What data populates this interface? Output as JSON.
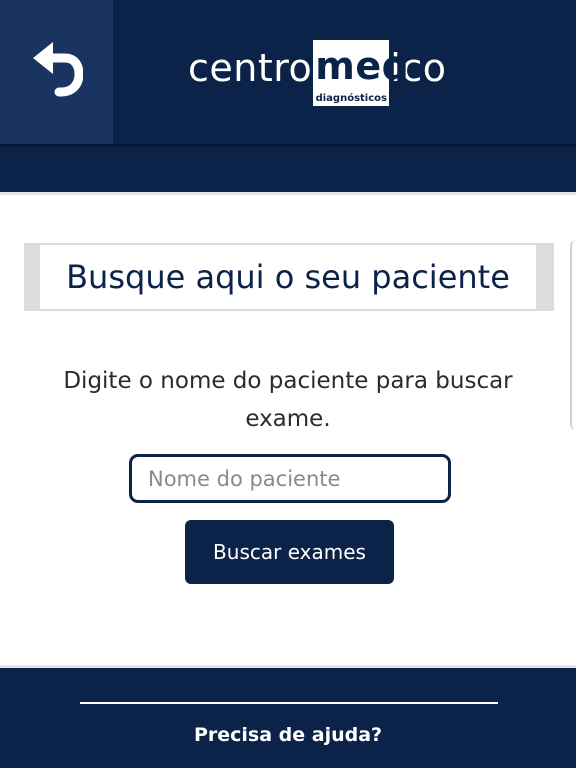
{
  "header": {
    "back_icon": "undo-arrow-icon",
    "logo": {
      "prefix": "centro",
      "highlight": "med",
      "suffix": "ico",
      "tagline": "diagnósticos"
    }
  },
  "search": {
    "title": "Busque aqui o seu paciente",
    "instructions": "Digite o nome do paciente para buscar exame.",
    "placeholder": "Nome do paciente",
    "value": "",
    "button_label": "Buscar exames"
  },
  "footer": {
    "help_label": "Precisa de ajuda?"
  },
  "colors": {
    "primary": "#0b2249",
    "back_button_bg": "#193461",
    "title_border": "#dcdcdc"
  }
}
